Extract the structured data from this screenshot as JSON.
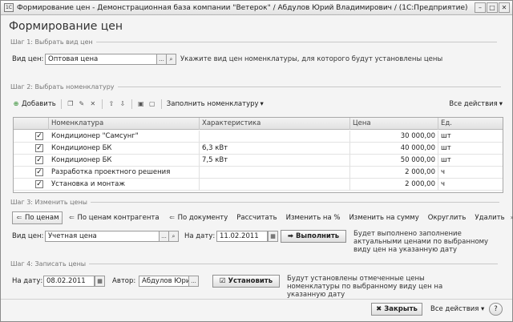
{
  "window": {
    "title": "Формирование цен - Демонстрационная база компании \"Ветерок\" / Абдулов Юрий Владимирович / (1С:Предприятие)",
    "app_icon": "1С"
  },
  "form_title": "Формирование цен",
  "step1": {
    "title": "Шаг 1: Выбрать вид цен",
    "label": "Вид цен:",
    "value": "Оптовая цена",
    "hint": "Укажите вид цен номенклатуры, для которого будут установлены цены"
  },
  "step2": {
    "title": "Шаг 2: Выбрать номенклатуру",
    "add": "Добавить",
    "fill": "Заполнить номенклатуру",
    "all_actions": "Все действия",
    "columns": [
      "Номенклатура",
      "Характеристика",
      "Цена",
      "Ед."
    ],
    "rows": [
      {
        "name": "Кондиционер \"Самсунг\"",
        "char": "",
        "price": "30 000,00",
        "unit": "шт"
      },
      {
        "name": "Кондиционер БК",
        "char": "6,3 кВт",
        "price": "40 000,00",
        "unit": "шт"
      },
      {
        "name": "Кондиционер БК",
        "char": "7,5 кВт",
        "price": "50 000,00",
        "unit": "шт"
      },
      {
        "name": "Разработка проектного решения",
        "char": "",
        "price": "2 000,00",
        "unit": "ч"
      },
      {
        "name": "Установка и монтаж",
        "char": "",
        "price": "2 000,00",
        "unit": "ч"
      }
    ]
  },
  "step3": {
    "title": "Шаг 3: Изменить цены",
    "tabs": [
      "По ценам",
      "По ценам контрагента",
      "По документу",
      "Рассчитать",
      "Изменить на %",
      "Изменить на сумму",
      "Округлить",
      "Удалить"
    ],
    "price_label": "Вид цен:",
    "price_value": "Учетная цена",
    "date_label": "На дату:",
    "date_value": "11.02.2011",
    "run": "Выполнить",
    "hint": "Будет выполнено заполнение актуальными ценами по выбранному виду цен на указанную дату"
  },
  "step4": {
    "title": "Шаг 4: Записать цены",
    "date_label": "На дату:",
    "date_value": "08.02.2011",
    "author_label": "Автор:",
    "author_value": "Абдулов Юрий",
    "set": "Установить",
    "hint": "Будут установлены отмеченные цены номенклатуры по выбранному виду цен на указанную дату"
  },
  "footer": {
    "close": "Закрыть",
    "all_actions": "Все действия",
    "help": "?"
  }
}
